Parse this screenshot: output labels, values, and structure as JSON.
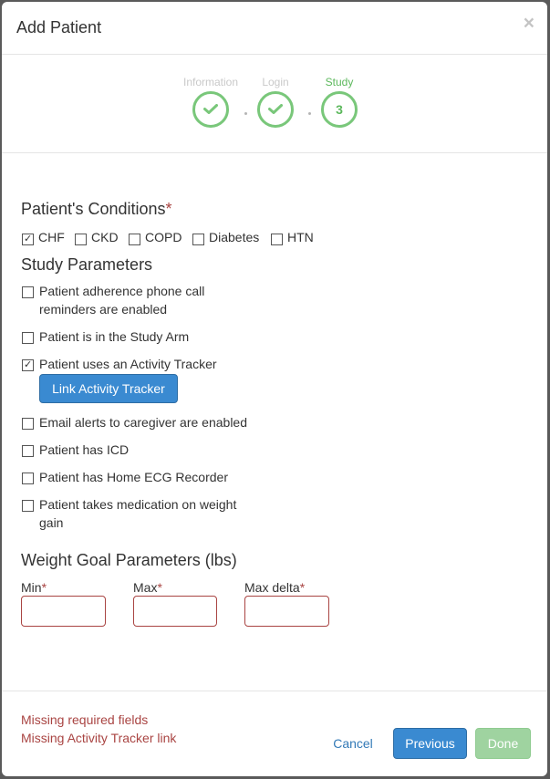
{
  "modal": {
    "title": "Add Patient",
    "close_symbol": "×"
  },
  "stepper": {
    "steps": [
      {
        "label": "Information",
        "state": "complete",
        "icon": "check-icon"
      },
      {
        "label": "Login",
        "state": "complete",
        "icon": "check-icon"
      },
      {
        "label": "Study",
        "state": "current",
        "number": "3"
      }
    ],
    "accent_color": "#5cb85c"
  },
  "conditions": {
    "title": "Patient's Conditions",
    "required_mark": "*",
    "items": [
      {
        "label": "CHF",
        "checked": true
      },
      {
        "label": "CKD",
        "checked": false
      },
      {
        "label": "COPD",
        "checked": false
      },
      {
        "label": "Diabetes",
        "checked": false
      },
      {
        "label": "HTN",
        "checked": false
      }
    ]
  },
  "study": {
    "title": "Study Parameters",
    "items": [
      {
        "label": "Patient adherence phone call reminders are enabled",
        "checked": false
      },
      {
        "label": "Patient is in the Study Arm",
        "checked": false
      },
      {
        "label": "Patient uses an Activity Tracker",
        "checked": true
      },
      {
        "label": "Email alerts to caregiver are enabled",
        "checked": false
      },
      {
        "label": "Patient has ICD",
        "checked": false
      },
      {
        "label": "Patient has Home ECG Recorder",
        "checked": false
      },
      {
        "label": "Patient takes medication on weight gain",
        "checked": false
      }
    ],
    "link_tracker_button": "Link Activity Tracker"
  },
  "weight": {
    "title": "Weight Goal Parameters (lbs)",
    "fields": [
      {
        "label": "Min",
        "required_mark": "*",
        "value": ""
      },
      {
        "label": "Max",
        "required_mark": "*",
        "value": ""
      },
      {
        "label": "Max delta",
        "required_mark": "*",
        "value": ""
      }
    ]
  },
  "footer": {
    "errors": [
      "Missing required fields",
      "Missing Activity Tracker link"
    ],
    "cancel_label": "Cancel",
    "previous_label": "Previous",
    "done_label": "Done",
    "error_color": "#a94442",
    "primary_color": "#3a8ad1",
    "success_disabled_color": "#9fd3a0"
  }
}
